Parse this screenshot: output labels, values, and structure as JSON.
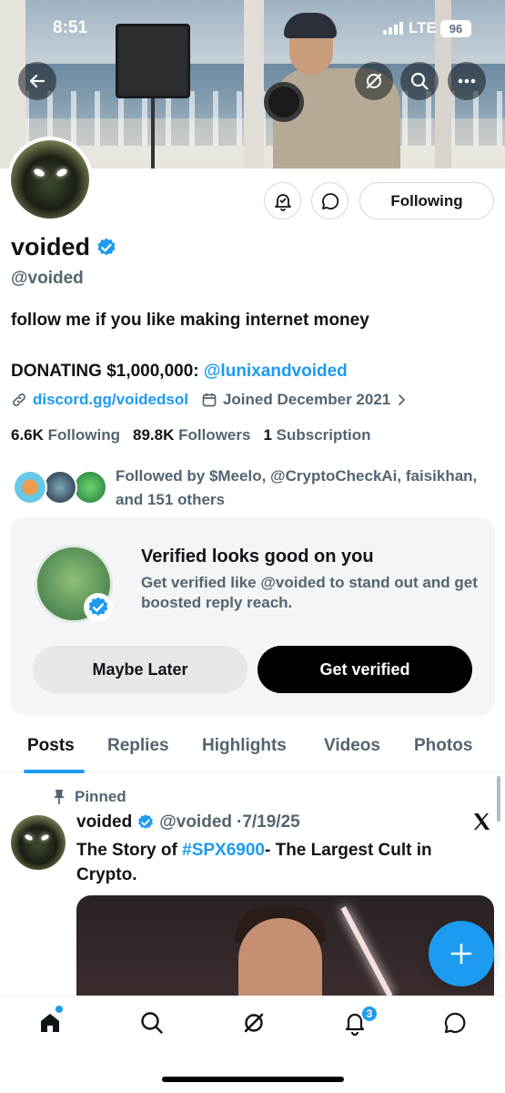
{
  "status_bar": {
    "time": "8:51",
    "network": "LTE",
    "battery": "96"
  },
  "profile": {
    "name": "voided",
    "handle": "@voided",
    "bio": "follow me if you like making internet money",
    "donating_label": "DONATING $1,000,000: ",
    "donating_link": "@lunixandvoided",
    "website": "discord.gg/voidedsol",
    "joined": "Joined December 2021",
    "following_count": "6.6K",
    "following_label": "Following",
    "followers_count": "89.8K",
    "followers_label": "Followers",
    "subscription_count": "1",
    "subscription_label": "Subscription",
    "followed_by": "Followed by $Meelo, @CryptoCheckAi, faisikhan, and 151 others",
    "following_button": "Following"
  },
  "verify_card": {
    "title": "Verified looks good on you",
    "subtitle": "Get verified like @voided to stand out and get boosted reply reach.",
    "later_button": "Maybe Later",
    "verify_button": "Get verified"
  },
  "tabs": [
    "Posts",
    "Replies",
    "Highlights",
    "Videos",
    "Photos"
  ],
  "post": {
    "pinned_label": "Pinned",
    "author": "voided",
    "handle": "@voided",
    "date": "·7/19/25",
    "text_before": "The Story of ",
    "hashtag": "#SPX6900",
    "text_after": "- The Largest Cult in Crypto."
  },
  "nav": {
    "notifications_badge": "3"
  },
  "colors": {
    "accent": "#1d9bf0",
    "muted": "#536471",
    "text": "#0f1419"
  }
}
